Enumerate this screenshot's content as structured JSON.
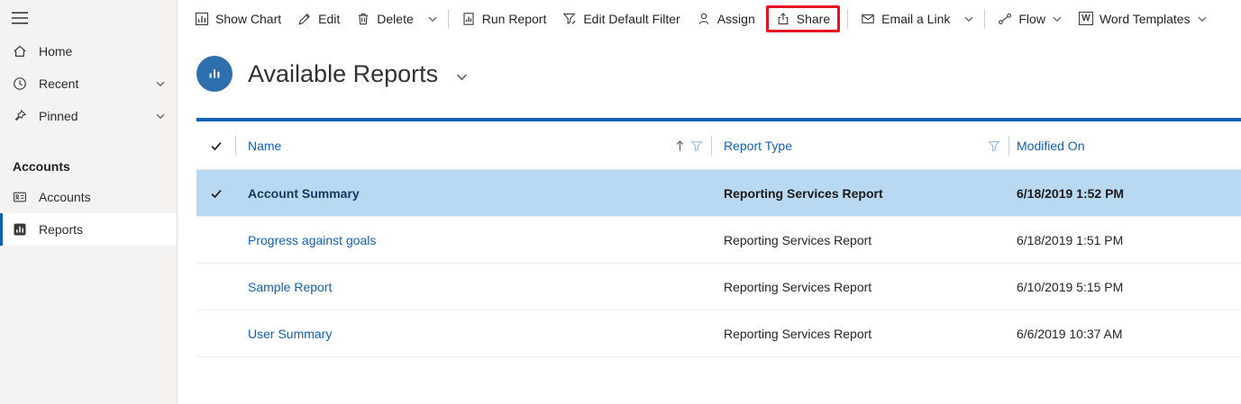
{
  "sidebar": {
    "home": "Home",
    "recent": "Recent",
    "pinned": "Pinned",
    "group_label": "Accounts",
    "accounts": "Accounts",
    "reports": "Reports"
  },
  "command_bar": {
    "show_chart": "Show Chart",
    "edit": "Edit",
    "delete": "Delete",
    "run_report": "Run Report",
    "edit_default_filter": "Edit Default Filter",
    "assign": "Assign",
    "share": "Share",
    "email_a_link": "Email a Link",
    "flow": "Flow",
    "word_templates": "Word Templates"
  },
  "page": {
    "title": "Available Reports"
  },
  "table": {
    "columns": {
      "name": "Name",
      "report_type": "Report Type",
      "modified_on": "Modified On"
    },
    "rows": [
      {
        "name": "Account Summary",
        "report_type": "Reporting Services Report",
        "modified_on": "6/18/2019 1:52 PM",
        "selected": true
      },
      {
        "name": "Progress against goals",
        "report_type": "Reporting Services Report",
        "modified_on": "6/18/2019 1:51 PM",
        "selected": false
      },
      {
        "name": "Sample Report",
        "report_type": "Reporting Services Report",
        "modified_on": "6/10/2019 5:15 PM",
        "selected": false
      },
      {
        "name": "User Summary",
        "report_type": "Reporting Services Report",
        "modified_on": "6/6/2019 10:37 AM",
        "selected": false
      }
    ]
  },
  "annotation": {
    "share_highlight_color": "#e81123"
  },
  "icons": {
    "word_glyph": "W"
  },
  "colors": {
    "selected_row_bg": "#b9d8f2",
    "link_blue": "#1160b7",
    "grid_top_border": "#1160b7",
    "entity_icon_bg": "#2e6fad"
  }
}
